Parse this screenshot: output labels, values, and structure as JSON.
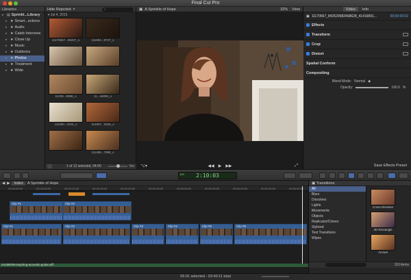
{
  "app": {
    "title": "Final Cut Pro"
  },
  "libraries": {
    "header": "Libraries",
    "items": [
      {
        "label": "Sprinkl...Library",
        "root": true,
        "selected": false
      },
      {
        "label": "Smart...ections",
        "selected": false
      },
      {
        "label": "Audio",
        "selected": false
      },
      {
        "label": "Caleb Interview",
        "selected": false
      },
      {
        "label": "Close Up",
        "selected": false
      },
      {
        "label": "Music",
        "selected": false
      },
      {
        "label": "Outdoors",
        "selected": false
      },
      {
        "label": "Photos",
        "selected": true
      },
      {
        "label": "Treatment",
        "selected": false
      },
      {
        "label": "Wide",
        "selected": false
      }
    ]
  },
  "browser": {
    "filter": "Hide Rejected",
    "date": "Jul 4, 2015",
    "thumbs": [
      {
        "label": "11170667...06207_o",
        "c1": "#b45a34",
        "c2": "#2a1a14"
      },
      {
        "label": "111684...8747_o",
        "c1": "#3a2a1c",
        "c2": "#1c140e"
      },
      {
        "label": "",
        "c1": "#d8c8b0",
        "c2": "#6a5038"
      },
      {
        "label": "",
        "c1": "#c8a880",
        "c2": "#5a4028"
      },
      {
        "label": "11406...8086_o",
        "c1": "#b08860",
        "c2": "#6a4a30"
      },
      {
        "label": "11...n6096_o",
        "c1": "#c8a878",
        "c2": "#382818"
      },
      {
        "label": "111050...3104_o",
        "c1": "#e8e0d0",
        "c2": "#a89878"
      },
      {
        "label": "114607...2536_o",
        "c1": "#b0683a",
        "c2": "#4a2818"
      },
      {
        "label": "",
        "c1": "#a07048",
        "c2": "#3a2414"
      },
      {
        "label": "111485...7998_o",
        "c1": "#c88a50",
        "c2": "#4a3020"
      }
    ],
    "selection_count": "1 of 12 selected, 04:00",
    "zoom_label": "5m"
  },
  "viewer": {
    "title": "A Sprinkle of Hope",
    "zoom": "32%",
    "view_menu": "View"
  },
  "inspector": {
    "tabs": [
      "Video",
      "Info"
    ],
    "active_tab": 0,
    "clip_name": "11170667_842529582468628_41416891...",
    "clip_timecode": "00:00:00:02",
    "sections": [
      {
        "label": "Effects",
        "checkbox": true
      },
      {
        "label": "Transform",
        "checkbox": true
      },
      {
        "label": "Crop",
        "checkbox": true
      },
      {
        "label": "Distort",
        "checkbox": true
      },
      {
        "label": "Spatial Conform",
        "checkbox": false
      },
      {
        "label": "Compositing",
        "checkbox": false
      }
    ],
    "blend_mode_label": "Blend Mode:",
    "blend_mode_value": "Normal",
    "opacity_label": "Opacity:",
    "opacity_value": "100.0",
    "opacity_unit": "%",
    "opacity_fraction": 1.0,
    "save_preset": "Save Effects Preset"
  },
  "toolbar": {
    "timecode": "2:10:03",
    "timecode_small": "100"
  },
  "timeline": {
    "project": "A Sprinkle of Hope",
    "right_label": "Index",
    "ruler": [
      "00:00:00:00",
      "00:00:05:00",
      "00:00:10:00",
      "00:00:15:00",
      "00:00:20:00",
      "00:00:25:00",
      "00:00:30:00",
      "00:00:35:00",
      "00:00:40:00",
      "00:00:45:00",
      "00:00:50:00"
    ],
    "upper_clips": [
      {
        "label": "Clip #1"
      },
      {
        "label": "Clip #2"
      }
    ],
    "lower_clips": [
      {
        "label": "Clip #1"
      },
      {
        "label": "Clip #2"
      },
      {
        "label": "Clip #3"
      },
      {
        "label": "Clip #4"
      },
      {
        "label": "Clip #5"
      },
      {
        "label": "Clip #6"
      }
    ],
    "audio_label": "04188039-inspiring-acoustic-guitar.aiff"
  },
  "transitions": {
    "header": "Transitions",
    "categories": [
      "All",
      "Blurs",
      "Dissolves",
      "Lights",
      "Movements",
      "Objects",
      "Replicator/Clones",
      "Stylized",
      "Text Transitions",
      "Wipes"
    ],
    "selected_index": 0,
    "thumbs": [
      {
        "label": "Cross Dissolve",
        "c1": "#c88a60",
        "c2": "#6a3a2a"
      },
      {
        "label": "3D Rectangle",
        "c1": "#d8a070",
        "c2": "#3a2a4a"
      },
      {
        "label": "Arrows",
        "c1": "#e8a860",
        "c2": "#5a3020"
      }
    ],
    "count": "110 items"
  },
  "status": {
    "text": "05:01 selected - 03:40:11 total"
  },
  "colors": {
    "accent": "#4a5f8a",
    "clip": "#355f94",
    "timecode": "#8fd18f"
  }
}
